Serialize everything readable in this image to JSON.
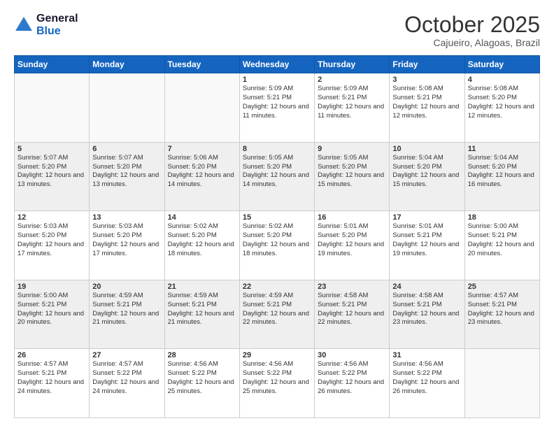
{
  "header": {
    "logo_line1": "General",
    "logo_line2": "Blue",
    "month_title": "October 2025",
    "location": "Cajueiro, Alagoas, Brazil"
  },
  "weekdays": [
    "Sunday",
    "Monday",
    "Tuesday",
    "Wednesday",
    "Thursday",
    "Friday",
    "Saturday"
  ],
  "weeks": [
    [
      {
        "day": "",
        "sunrise": "",
        "sunset": "",
        "daylight": ""
      },
      {
        "day": "",
        "sunrise": "",
        "sunset": "",
        "daylight": ""
      },
      {
        "day": "",
        "sunrise": "",
        "sunset": "",
        "daylight": ""
      },
      {
        "day": "1",
        "sunrise": "Sunrise: 5:09 AM",
        "sunset": "Sunset: 5:21 PM",
        "daylight": "Daylight: 12 hours and 11 minutes."
      },
      {
        "day": "2",
        "sunrise": "Sunrise: 5:09 AM",
        "sunset": "Sunset: 5:21 PM",
        "daylight": "Daylight: 12 hours and 11 minutes."
      },
      {
        "day": "3",
        "sunrise": "Sunrise: 5:08 AM",
        "sunset": "Sunset: 5:21 PM",
        "daylight": "Daylight: 12 hours and 12 minutes."
      },
      {
        "day": "4",
        "sunrise": "Sunrise: 5:08 AM",
        "sunset": "Sunset: 5:20 PM",
        "daylight": "Daylight: 12 hours and 12 minutes."
      }
    ],
    [
      {
        "day": "5",
        "sunrise": "Sunrise: 5:07 AM",
        "sunset": "Sunset: 5:20 PM",
        "daylight": "Daylight: 12 hours and 13 minutes."
      },
      {
        "day": "6",
        "sunrise": "Sunrise: 5:07 AM",
        "sunset": "Sunset: 5:20 PM",
        "daylight": "Daylight: 12 hours and 13 minutes."
      },
      {
        "day": "7",
        "sunrise": "Sunrise: 5:06 AM",
        "sunset": "Sunset: 5:20 PM",
        "daylight": "Daylight: 12 hours and 14 minutes."
      },
      {
        "day": "8",
        "sunrise": "Sunrise: 5:05 AM",
        "sunset": "Sunset: 5:20 PM",
        "daylight": "Daylight: 12 hours and 14 minutes."
      },
      {
        "day": "9",
        "sunrise": "Sunrise: 5:05 AM",
        "sunset": "Sunset: 5:20 PM",
        "daylight": "Daylight: 12 hours and 15 minutes."
      },
      {
        "day": "10",
        "sunrise": "Sunrise: 5:04 AM",
        "sunset": "Sunset: 5:20 PM",
        "daylight": "Daylight: 12 hours and 15 minutes."
      },
      {
        "day": "11",
        "sunrise": "Sunrise: 5:04 AM",
        "sunset": "Sunset: 5:20 PM",
        "daylight": "Daylight: 12 hours and 16 minutes."
      }
    ],
    [
      {
        "day": "12",
        "sunrise": "Sunrise: 5:03 AM",
        "sunset": "Sunset: 5:20 PM",
        "daylight": "Daylight: 12 hours and 17 minutes."
      },
      {
        "day": "13",
        "sunrise": "Sunrise: 5:03 AM",
        "sunset": "Sunset: 5:20 PM",
        "daylight": "Daylight: 12 hours and 17 minutes."
      },
      {
        "day": "14",
        "sunrise": "Sunrise: 5:02 AM",
        "sunset": "Sunset: 5:20 PM",
        "daylight": "Daylight: 12 hours and 18 minutes."
      },
      {
        "day": "15",
        "sunrise": "Sunrise: 5:02 AM",
        "sunset": "Sunset: 5:20 PM",
        "daylight": "Daylight: 12 hours and 18 minutes."
      },
      {
        "day": "16",
        "sunrise": "Sunrise: 5:01 AM",
        "sunset": "Sunset: 5:20 PM",
        "daylight": "Daylight: 12 hours and 19 minutes."
      },
      {
        "day": "17",
        "sunrise": "Sunrise: 5:01 AM",
        "sunset": "Sunset: 5:21 PM",
        "daylight": "Daylight: 12 hours and 19 minutes."
      },
      {
        "day": "18",
        "sunrise": "Sunrise: 5:00 AM",
        "sunset": "Sunset: 5:21 PM",
        "daylight": "Daylight: 12 hours and 20 minutes."
      }
    ],
    [
      {
        "day": "19",
        "sunrise": "Sunrise: 5:00 AM",
        "sunset": "Sunset: 5:21 PM",
        "daylight": "Daylight: 12 hours and 20 minutes."
      },
      {
        "day": "20",
        "sunrise": "Sunrise: 4:59 AM",
        "sunset": "Sunset: 5:21 PM",
        "daylight": "Daylight: 12 hours and 21 minutes."
      },
      {
        "day": "21",
        "sunrise": "Sunrise: 4:59 AM",
        "sunset": "Sunset: 5:21 PM",
        "daylight": "Daylight: 12 hours and 21 minutes."
      },
      {
        "day": "22",
        "sunrise": "Sunrise: 4:59 AM",
        "sunset": "Sunset: 5:21 PM",
        "daylight": "Daylight: 12 hours and 22 minutes."
      },
      {
        "day": "23",
        "sunrise": "Sunrise: 4:58 AM",
        "sunset": "Sunset: 5:21 PM",
        "daylight": "Daylight: 12 hours and 22 minutes."
      },
      {
        "day": "24",
        "sunrise": "Sunrise: 4:58 AM",
        "sunset": "Sunset: 5:21 PM",
        "daylight": "Daylight: 12 hours and 23 minutes."
      },
      {
        "day": "25",
        "sunrise": "Sunrise: 4:57 AM",
        "sunset": "Sunset: 5:21 PM",
        "daylight": "Daylight: 12 hours and 23 minutes."
      }
    ],
    [
      {
        "day": "26",
        "sunrise": "Sunrise: 4:57 AM",
        "sunset": "Sunset: 5:21 PM",
        "daylight": "Daylight: 12 hours and 24 minutes."
      },
      {
        "day": "27",
        "sunrise": "Sunrise: 4:57 AM",
        "sunset": "Sunset: 5:22 PM",
        "daylight": "Daylight: 12 hours and 24 minutes."
      },
      {
        "day": "28",
        "sunrise": "Sunrise: 4:56 AM",
        "sunset": "Sunset: 5:22 PM",
        "daylight": "Daylight: 12 hours and 25 minutes."
      },
      {
        "day": "29",
        "sunrise": "Sunrise: 4:56 AM",
        "sunset": "Sunset: 5:22 PM",
        "daylight": "Daylight: 12 hours and 25 minutes."
      },
      {
        "day": "30",
        "sunrise": "Sunrise: 4:56 AM",
        "sunset": "Sunset: 5:22 PM",
        "daylight": "Daylight: 12 hours and 26 minutes."
      },
      {
        "day": "31",
        "sunrise": "Sunrise: 4:56 AM",
        "sunset": "Sunset: 5:22 PM",
        "daylight": "Daylight: 12 hours and 26 minutes."
      },
      {
        "day": "",
        "sunrise": "",
        "sunset": "",
        "daylight": ""
      }
    ]
  ]
}
